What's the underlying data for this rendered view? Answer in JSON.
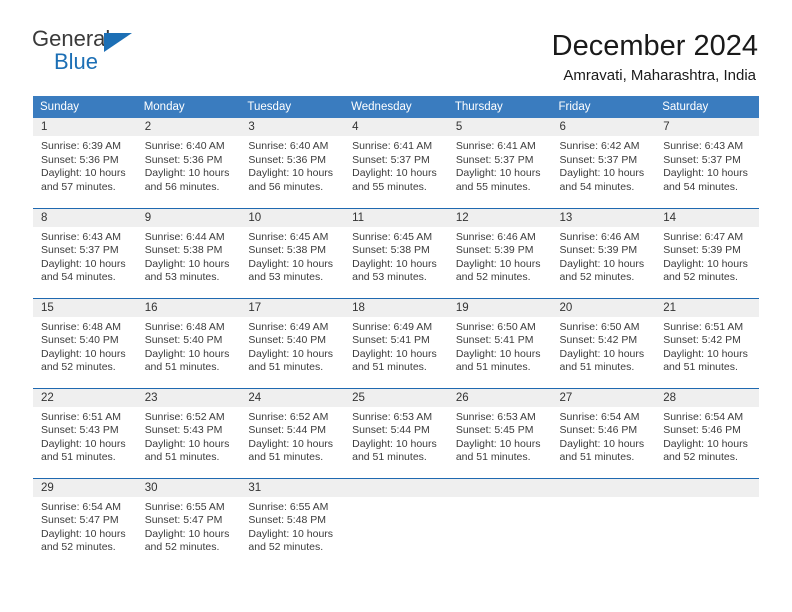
{
  "logo": {
    "word1": "General",
    "word2": "Blue",
    "icon": "triangle-logo-mark"
  },
  "header": {
    "title": "December 2024",
    "location": "Amravati, Maharashtra, India"
  },
  "colors": {
    "header_blue": "#3a7cbf",
    "rule_blue": "#1f69b0",
    "daynum_bg": "#efefef",
    "logo_blue": "#1c6fb5"
  },
  "weekdays": [
    "Sunday",
    "Monday",
    "Tuesday",
    "Wednesday",
    "Thursday",
    "Friday",
    "Saturday"
  ],
  "labels": {
    "sunrise_prefix": "Sunrise: ",
    "sunset_prefix": "Sunset: ",
    "daylight_prefix": "Daylight: "
  },
  "weeks": [
    [
      {
        "day": "1",
        "sunrise": "Sunrise: 6:39 AM",
        "sunset": "Sunset: 5:36 PM",
        "daylight": "Daylight: 10 hours and 57 minutes."
      },
      {
        "day": "2",
        "sunrise": "Sunrise: 6:40 AM",
        "sunset": "Sunset: 5:36 PM",
        "daylight": "Daylight: 10 hours and 56 minutes."
      },
      {
        "day": "3",
        "sunrise": "Sunrise: 6:40 AM",
        "sunset": "Sunset: 5:36 PM",
        "daylight": "Daylight: 10 hours and 56 minutes."
      },
      {
        "day": "4",
        "sunrise": "Sunrise: 6:41 AM",
        "sunset": "Sunset: 5:37 PM",
        "daylight": "Daylight: 10 hours and 55 minutes."
      },
      {
        "day": "5",
        "sunrise": "Sunrise: 6:41 AM",
        "sunset": "Sunset: 5:37 PM",
        "daylight": "Daylight: 10 hours and 55 minutes."
      },
      {
        "day": "6",
        "sunrise": "Sunrise: 6:42 AM",
        "sunset": "Sunset: 5:37 PM",
        "daylight": "Daylight: 10 hours and 54 minutes."
      },
      {
        "day": "7",
        "sunrise": "Sunrise: 6:43 AM",
        "sunset": "Sunset: 5:37 PM",
        "daylight": "Daylight: 10 hours and 54 minutes."
      }
    ],
    [
      {
        "day": "8",
        "sunrise": "Sunrise: 6:43 AM",
        "sunset": "Sunset: 5:37 PM",
        "daylight": "Daylight: 10 hours and 54 minutes."
      },
      {
        "day": "9",
        "sunrise": "Sunrise: 6:44 AM",
        "sunset": "Sunset: 5:38 PM",
        "daylight": "Daylight: 10 hours and 53 minutes."
      },
      {
        "day": "10",
        "sunrise": "Sunrise: 6:45 AM",
        "sunset": "Sunset: 5:38 PM",
        "daylight": "Daylight: 10 hours and 53 minutes."
      },
      {
        "day": "11",
        "sunrise": "Sunrise: 6:45 AM",
        "sunset": "Sunset: 5:38 PM",
        "daylight": "Daylight: 10 hours and 53 minutes."
      },
      {
        "day": "12",
        "sunrise": "Sunrise: 6:46 AM",
        "sunset": "Sunset: 5:39 PM",
        "daylight": "Daylight: 10 hours and 52 minutes."
      },
      {
        "day": "13",
        "sunrise": "Sunrise: 6:46 AM",
        "sunset": "Sunset: 5:39 PM",
        "daylight": "Daylight: 10 hours and 52 minutes."
      },
      {
        "day": "14",
        "sunrise": "Sunrise: 6:47 AM",
        "sunset": "Sunset: 5:39 PM",
        "daylight": "Daylight: 10 hours and 52 minutes."
      }
    ],
    [
      {
        "day": "15",
        "sunrise": "Sunrise: 6:48 AM",
        "sunset": "Sunset: 5:40 PM",
        "daylight": "Daylight: 10 hours and 52 minutes."
      },
      {
        "day": "16",
        "sunrise": "Sunrise: 6:48 AM",
        "sunset": "Sunset: 5:40 PM",
        "daylight": "Daylight: 10 hours and 51 minutes."
      },
      {
        "day": "17",
        "sunrise": "Sunrise: 6:49 AM",
        "sunset": "Sunset: 5:40 PM",
        "daylight": "Daylight: 10 hours and 51 minutes."
      },
      {
        "day": "18",
        "sunrise": "Sunrise: 6:49 AM",
        "sunset": "Sunset: 5:41 PM",
        "daylight": "Daylight: 10 hours and 51 minutes."
      },
      {
        "day": "19",
        "sunrise": "Sunrise: 6:50 AM",
        "sunset": "Sunset: 5:41 PM",
        "daylight": "Daylight: 10 hours and 51 minutes."
      },
      {
        "day": "20",
        "sunrise": "Sunrise: 6:50 AM",
        "sunset": "Sunset: 5:42 PM",
        "daylight": "Daylight: 10 hours and 51 minutes."
      },
      {
        "day": "21",
        "sunrise": "Sunrise: 6:51 AM",
        "sunset": "Sunset: 5:42 PM",
        "daylight": "Daylight: 10 hours and 51 minutes."
      }
    ],
    [
      {
        "day": "22",
        "sunrise": "Sunrise: 6:51 AM",
        "sunset": "Sunset: 5:43 PM",
        "daylight": "Daylight: 10 hours and 51 minutes."
      },
      {
        "day": "23",
        "sunrise": "Sunrise: 6:52 AM",
        "sunset": "Sunset: 5:43 PM",
        "daylight": "Daylight: 10 hours and 51 minutes."
      },
      {
        "day": "24",
        "sunrise": "Sunrise: 6:52 AM",
        "sunset": "Sunset: 5:44 PM",
        "daylight": "Daylight: 10 hours and 51 minutes."
      },
      {
        "day": "25",
        "sunrise": "Sunrise: 6:53 AM",
        "sunset": "Sunset: 5:44 PM",
        "daylight": "Daylight: 10 hours and 51 minutes."
      },
      {
        "day": "26",
        "sunrise": "Sunrise: 6:53 AM",
        "sunset": "Sunset: 5:45 PM",
        "daylight": "Daylight: 10 hours and 51 minutes."
      },
      {
        "day": "27",
        "sunrise": "Sunrise: 6:54 AM",
        "sunset": "Sunset: 5:46 PM",
        "daylight": "Daylight: 10 hours and 51 minutes."
      },
      {
        "day": "28",
        "sunrise": "Sunrise: 6:54 AM",
        "sunset": "Sunset: 5:46 PM",
        "daylight": "Daylight: 10 hours and 52 minutes."
      }
    ],
    [
      {
        "day": "29",
        "sunrise": "Sunrise: 6:54 AM",
        "sunset": "Sunset: 5:47 PM",
        "daylight": "Daylight: 10 hours and 52 minutes."
      },
      {
        "day": "30",
        "sunrise": "Sunrise: 6:55 AM",
        "sunset": "Sunset: 5:47 PM",
        "daylight": "Daylight: 10 hours and 52 minutes."
      },
      {
        "day": "31",
        "sunrise": "Sunrise: 6:55 AM",
        "sunset": "Sunset: 5:48 PM",
        "daylight": "Daylight: 10 hours and 52 minutes."
      },
      {
        "day": "",
        "sunrise": "",
        "sunset": "",
        "daylight": ""
      },
      {
        "day": "",
        "sunrise": "",
        "sunset": "",
        "daylight": ""
      },
      {
        "day": "",
        "sunrise": "",
        "sunset": "",
        "daylight": ""
      },
      {
        "day": "",
        "sunrise": "",
        "sunset": "",
        "daylight": ""
      }
    ]
  ]
}
